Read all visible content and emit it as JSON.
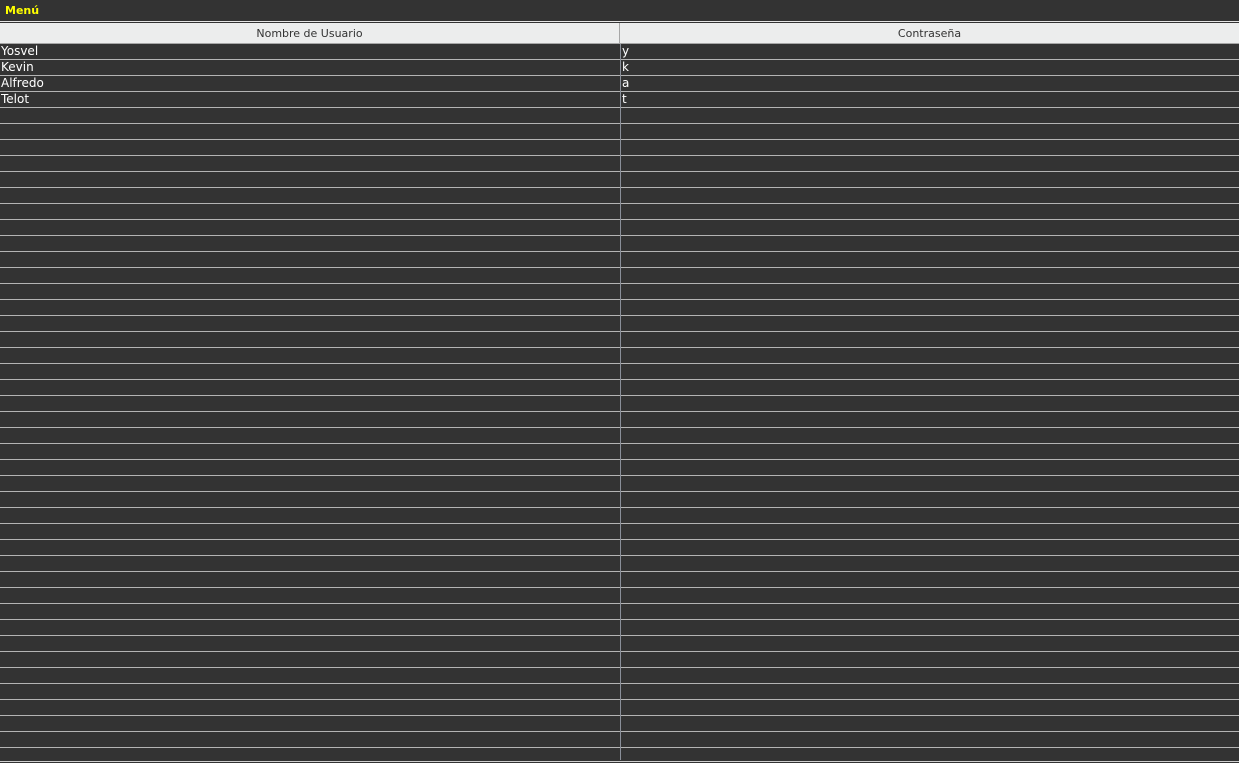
{
  "menubar": {
    "menu_label": "Menú"
  },
  "table": {
    "columns": [
      "Nombre de Usuario",
      "Contraseña"
    ],
    "rows": [
      [
        "Yosvel",
        "y"
      ],
      [
        "Kevin",
        "k"
      ],
      [
        "Alfredo",
        "a"
      ],
      [
        "Telot",
        "t"
      ]
    ],
    "total_visible_rows": 45
  },
  "colors": {
    "background": "#333333",
    "menu_text": "#ffff00",
    "header_bg": "#eceded",
    "cell_text": "#ffffff",
    "grid_line": "#b4b4b4"
  }
}
